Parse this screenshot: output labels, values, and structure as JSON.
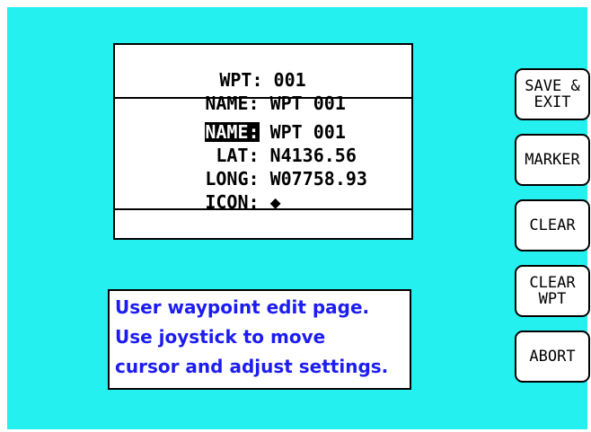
{
  "colors": {
    "screen_background": "#25f0f0",
    "help_text": "#1c1cf0",
    "panel_background": "#ffffff",
    "outline": "#000000"
  },
  "waypoint_panel": {
    "header": {
      "wpt_label": "WPT:",
      "wpt_value": "001",
      "name_label": "NAME:",
      "name_value": "WPT 001"
    },
    "fields": {
      "name_label": "NAME:",
      "name_value": "WPT 001",
      "lat_label": "LAT:",
      "lat_value": "N4136.56",
      "long_label": "LONG:",
      "long_value": "W07758.93",
      "icon_label": "ICON:",
      "icon_value": "◆",
      "icon_name": "diamond-icon"
    }
  },
  "help": {
    "line1": "User waypoint edit page.",
    "line2": "Use joystick to move",
    "line3": "cursor and adjust settings."
  },
  "softkeys": {
    "save_exit": {
      "line1": "SAVE &",
      "line2": "EXIT"
    },
    "marker": {
      "line1": "MARKER"
    },
    "clear": {
      "line1": "CLEAR"
    },
    "clear_wpt": {
      "line1": "CLEAR",
      "line2": "WPT"
    },
    "abort": {
      "line1": "ABORT"
    }
  }
}
